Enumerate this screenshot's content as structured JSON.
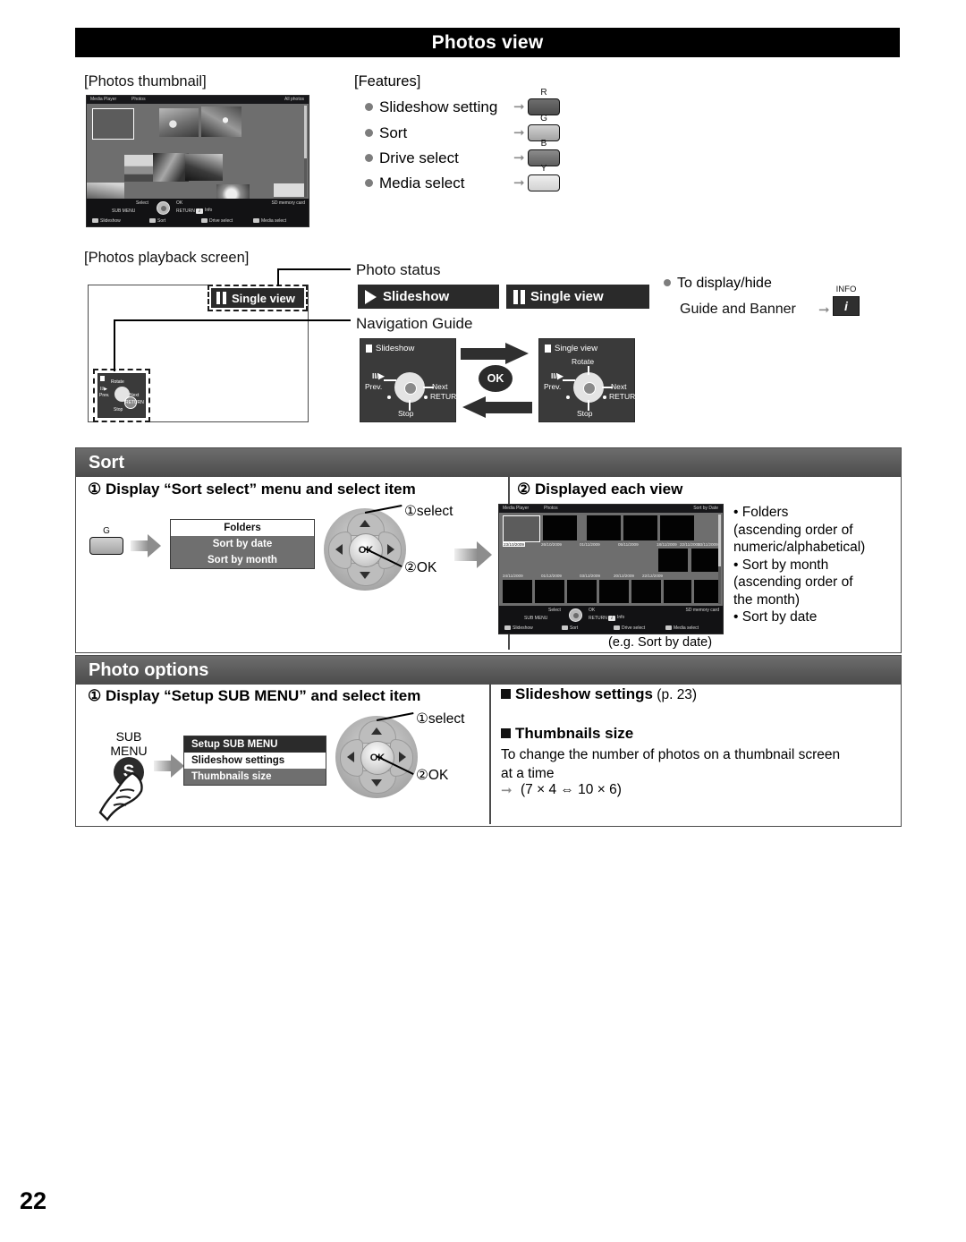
{
  "header": {
    "title": "Photos view"
  },
  "page": {
    "number": "22"
  },
  "thumbnail_section": {
    "caption": "[Photos thumbnail]",
    "screen": {
      "top_left": "Media Player",
      "top_mid": "Photos",
      "top_right": "All photos",
      "guide": {
        "select": "Select",
        "ok": "OK",
        "sub_menu": "SUB MENU",
        "return": "RETURN",
        "info": "Info",
        "media": "SD memory card",
        "slideshow": "Slideshow",
        "sort": "Sort",
        "drive_select": "Drive select",
        "media_select": "Media select"
      }
    }
  },
  "features": {
    "caption": "[Features]",
    "items": [
      {
        "label": "Slideshow setting",
        "key": "R"
      },
      {
        "label": "Sort",
        "key": "G"
      },
      {
        "label": "Drive select",
        "key": "B"
      },
      {
        "label": "Media select",
        "key": "Y"
      }
    ]
  },
  "playback_section": {
    "caption": "[Photos playback screen]",
    "callouts": {
      "photo_status": "Photo status",
      "navigation_guide": "Navigation Guide"
    },
    "badge_on_screen": "Single view",
    "status_badges": [
      {
        "label": "Slideshow",
        "icon": "play-icon"
      },
      {
        "label": "Single view",
        "icon": "pause-icon"
      }
    ],
    "nav_panels": [
      {
        "title": "Slideshow",
        "labels": {
          "playpause": "II/▶",
          "prev": "Prev.",
          "next": "Next",
          "return": "RETURN",
          "stop": "Stop",
          "rotate": ""
        }
      },
      {
        "title": "Single view",
        "labels": {
          "playpause": "II/▶",
          "prev": "Prev.",
          "next": "Next",
          "return": "RETURN",
          "stop": "Stop",
          "rotate": "Rotate"
        }
      }
    ],
    "ok_label": "OK",
    "display_hide": {
      "line1": "To display/hide",
      "line2": "Guide and Banner",
      "key_label": "INFO",
      "key_glyph": "i"
    }
  },
  "sort_section": {
    "title": "Sort",
    "step1": {
      "heading": "① Display “Sort select” menu and select item",
      "color_key": "G",
      "menu": [
        "Folders",
        "Sort by date",
        "Sort by month"
      ],
      "dpad": {
        "select_label": "①select",
        "ok_label": "②OK",
        "ok_text": "OK"
      }
    },
    "step2": {
      "heading": "② Displayed each view",
      "screen": {
        "top_left": "Media Player",
        "top_mid": "Photos",
        "top_right": "Sort by Date",
        "dates_row1": [
          "23/10/2009",
          "26/10/2009",
          "01/11/2009",
          "05/11/2009",
          "18/11/2009",
          "22/11/2009",
          "23/11/2009"
        ],
        "dates_row2": [
          "24/11/2009",
          "01/12/2009",
          "03/12/2009",
          "20/12/2009",
          "22/12/2009"
        ],
        "guide": {
          "select": "Select",
          "ok": "OK",
          "sub_menu": "SUB MENU",
          "return": "RETURN",
          "info": "Info",
          "media": "SD memory card",
          "slideshow": "Slideshow",
          "sort": "Sort",
          "drive_select": "Drive select",
          "media_select": "Media select"
        }
      },
      "example_caption": "(e.g. Sort by date)",
      "bullets": [
        "• Folders",
        "   (ascending order of",
        "   numeric/alphabetical)",
        "•  Sort by month",
        "   (ascending order of",
        "   the month)",
        "• Sort by date"
      ]
    }
  },
  "photo_options_section": {
    "title": "Photo options",
    "step1": {
      "heading": "① Display “Setup SUB MENU” and select item",
      "submenu_button": {
        "line1": "SUB",
        "line2": "MENU",
        "glyph": "S"
      },
      "menu_header": "Setup SUB MENU",
      "menu_items": [
        "Slideshow settings",
        "Thumbnails size"
      ],
      "dpad": {
        "select_label": "①select",
        "ok_label": "②OK",
        "ok_text": "OK"
      }
    },
    "right": {
      "slideshow_heading": "Slideshow settings",
      "slideshow_page_ref": "(p. 23)",
      "thumbnails_heading": "Thumbnails size",
      "thumbnails_text_line1": "To change the number of photos on a thumbnail screen",
      "thumbnails_text_line2": "at a time",
      "thumbnails_values": "(7 × 4 ⇔ 10 × 6)"
    }
  },
  "colors": {
    "header_bg": "#000000",
    "section_header_bg": "#5b5b5b",
    "screen_bg": "#6e6e6e",
    "panel_bg": "#3a3a3a",
    "accent_gray": "#8b8b8b"
  }
}
